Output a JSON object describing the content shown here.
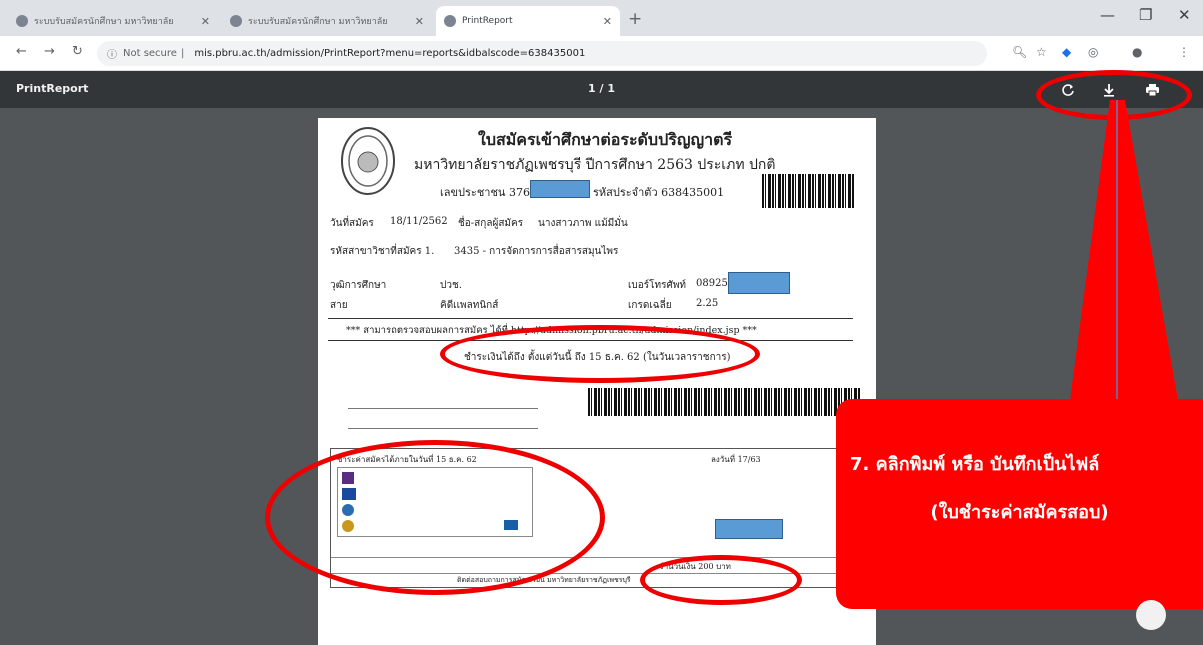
{
  "tabs": [
    {
      "title": "ระบบรับสมัครนักศึกษา มหาวิทยาลัย",
      "active": false
    },
    {
      "title": "ระบบรับสมัครนักศึกษา มหาวิทยาลัย",
      "active": false
    },
    {
      "title": "PrintReport",
      "active": true
    }
  ],
  "address": {
    "security": "Not secure",
    "url": "mis.pbru.ac.th/admission/PrintReport?menu=reports&idbalscode=638435001"
  },
  "pdf_viewer": {
    "title": "PrintReport",
    "page_indicator": "1 / 1"
  },
  "document": {
    "heading": "ใบสมัครเข้าศึกษาต่อระดับปริญญาตรี",
    "subheading": "มหาวิทยาลัยราชภัฏเพชรบุรี ปีการศึกษา 2563 ประเภท ปกติ",
    "id_label": "เลขประชาชน 37666",
    "applicant_code": "รหัสประจำตัว 638435001",
    "apply_date_label": "วันที่สมัคร",
    "apply_date": "18/11/2562",
    "name_label": "ชื่อ-สกุลผู้สมัคร",
    "name": "นางสาวภาพ แม้มีมั่น",
    "program_label": "รหัสสาขาวิชาที่สมัคร 1.",
    "program": "3435 - การจัดการการสื่อสารสมุนไพร",
    "education_label": "วุฒิการศึกษา",
    "education": "ปวช.",
    "phone_label": "เบอร์โทรศัพท์",
    "phone": "08925",
    "track_label": "สาย",
    "track": "คิดีเเพลทนิกส์",
    "gpa_label": "เกรดเฉลี่ย",
    "gpa": "2.25",
    "website_note": "*** สามารถตรวจสอบผลการสมัคร ได้ที่ http://admission.pbru.ac.th/admission/index.jsp ***",
    "deadline_note": "ชำระเงินได้ถึง ตั้งแต่วันนี้ ถึง 15 ธ.ค. 62 (ในวันเวลาราชการ)",
    "payment_header": "ชำระค่าสมัครได้ภายในวันที่ 15 ธ.ค. 62",
    "ref_label": "ลงวันที่ 17/63",
    "amount_label": "จำนวนเงิน 200 บาท",
    "footer": "ติดต่อสอบถามการสมัครเรียน มหาวิทยาลัยราชภัฏเพชรบุรี"
  },
  "callout": {
    "line1": "7. คลิกพิมพ์ หรือ บันทึกเป็นไฟล์",
    "line2": "(ใบชำระค่าสมัครสอบ)"
  }
}
